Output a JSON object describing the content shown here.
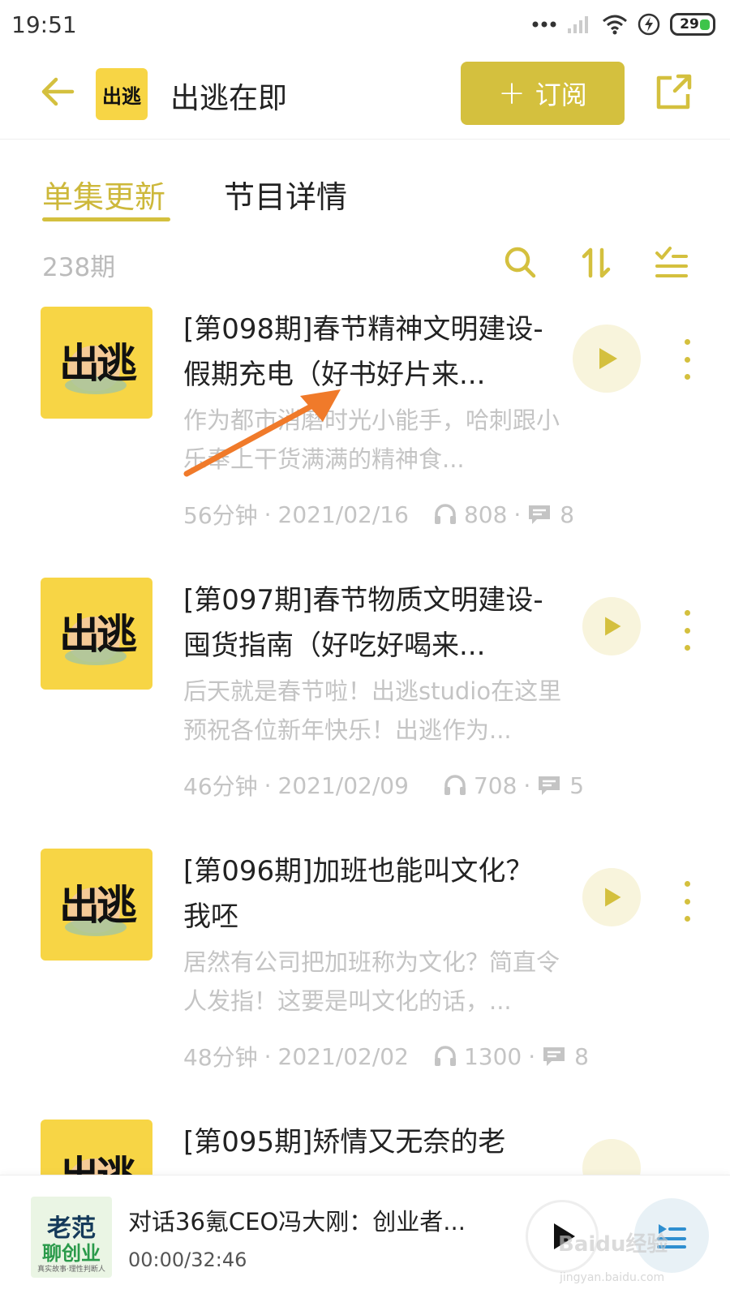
{
  "status_bar": {
    "time": "19:51",
    "battery": "29"
  },
  "header": {
    "podcast_logo_text": "出逃",
    "title": "出逃在即",
    "subscribe_plus": "+",
    "subscribe_label": "订阅"
  },
  "tabs": [
    {
      "label": "单集更新",
      "active": true
    },
    {
      "label": "节目详情",
      "active": false
    }
  ],
  "toolbar": {
    "episode_count": "238期"
  },
  "episodes": [
    {
      "cover_text": "出逃",
      "title": "[第098期]春节精神文明建设-假期充电（好书好片来...",
      "description": "作为都市消磨时光小能手，哈刺跟小乐奉上干货满满的精神食...",
      "duration": "56分钟",
      "date": "2021/02/16",
      "plays": "808",
      "comments": "8"
    },
    {
      "cover_text": "出逃",
      "title": "[第097期]春节物质文明建设-囤货指南（好吃好喝来...",
      "description": "后天就是春节啦！出逃studio在这里预祝各位新年快乐！出逃作为...",
      "duration": "46分钟",
      "date": "2021/02/09",
      "plays": "708",
      "comments": "5"
    },
    {
      "cover_text": "出逃",
      "title": "[第096期]加班也能叫文化？我呸",
      "description": "居然有公司把加班称为文化？简直令人发指！这要是叫文化的话，...",
      "duration": "48分钟",
      "date": "2021/02/02",
      "plays": "1300",
      "comments": "8"
    },
    {
      "cover_text": "出逃",
      "title": "[第095期]矫情又无奈的老",
      "description": "",
      "duration": "",
      "date": "",
      "plays": "",
      "comments": ""
    }
  ],
  "meta_separator": "·",
  "mini_player": {
    "cover_line1": "老范",
    "cover_line2": "聊创业",
    "cover_line3": "真实故事·理性判断人",
    "title": "对话36氪CEO冯大刚：创业者...",
    "time": "00:00/32:46"
  },
  "watermark": {
    "text": "Baidu经验",
    "sub": "jingyan.baidu.com"
  },
  "colors": {
    "accent": "#d4c03e",
    "accent_text": "#cdb83b",
    "muted_text": "#c4c4c4",
    "cover_yellow": "#f7d545",
    "annotation_arrow": "#f07a2a"
  }
}
